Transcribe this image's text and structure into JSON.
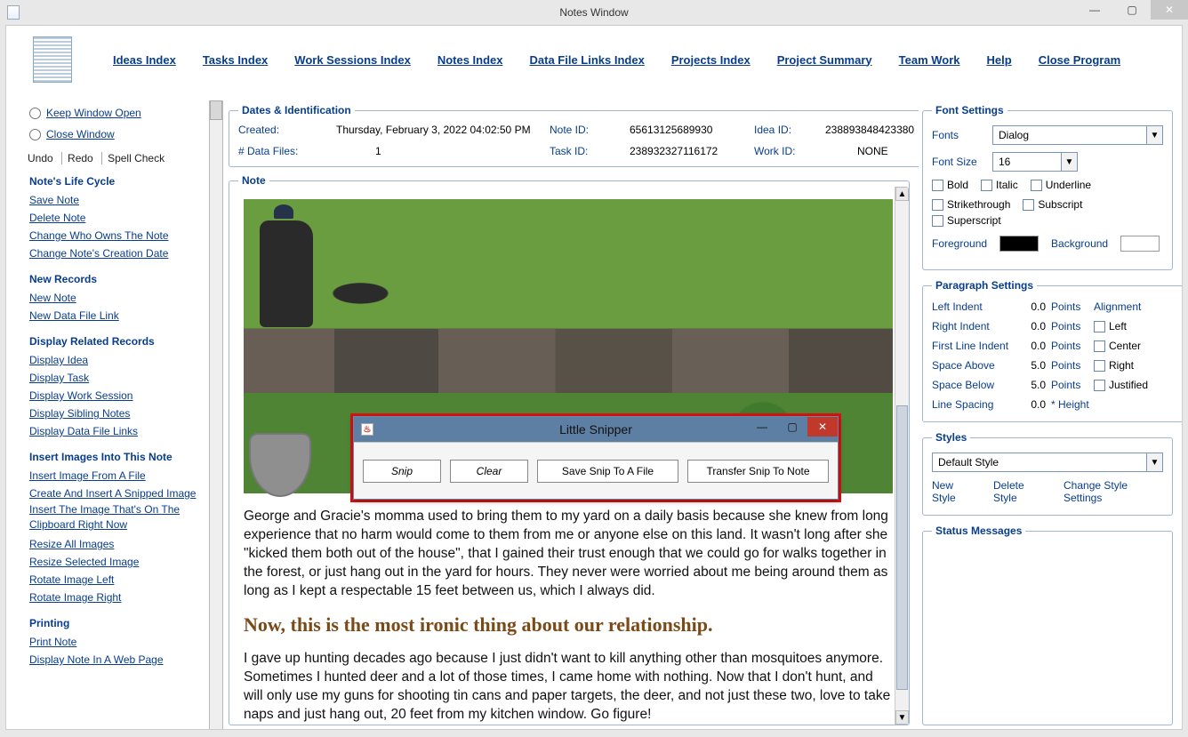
{
  "window": {
    "title": "Notes Window",
    "minimize": "—",
    "maximize": "▢",
    "close": "✕"
  },
  "menubar": {
    "ideas": "Ideas Index",
    "tasks": "Tasks Index",
    "work": "Work Sessions Index",
    "notes": "Notes Index",
    "files": "Data File Links Index",
    "projects": "Projects Index",
    "summary": "Project Summary",
    "team": "Team Work",
    "help": "Help",
    "close": "Close Program"
  },
  "left": {
    "keep_open": "Keep Window Open",
    "close_window": "Close Window",
    "undo": "Undo",
    "redo": "Redo",
    "spell": "Spell Check",
    "life_hdr": "Note's Life Cycle",
    "save": "Save Note",
    "delete": "Delete Note",
    "owner": "Change Who Owns The Note",
    "cdate": "Change Note's Creation Date",
    "new_hdr": "New Records",
    "new_note": "New Note",
    "new_link": "New Data File Link",
    "disp_hdr": "Display Related Records",
    "disp_idea": "Display Idea",
    "disp_task": "Display Task",
    "disp_ws": "Display Work Session",
    "disp_sib": "Display Sibling Notes",
    "disp_dfl": "Display Data File Links",
    "img_hdr": "Insert Images Into This Note",
    "img_file": "Insert Image From A File",
    "img_snip": "Create And Insert A Snipped Image",
    "img_clip": "Insert The Image That's On The Clipboard Right Now",
    "img_resize_all": "Resize All Images",
    "img_resize_sel": "Resize Selected Image",
    "img_rot_l": "Rotate Image Left",
    "img_rot_r": "Rotate Image Right",
    "print_hdr": "Printing",
    "print_note": "Print Note",
    "print_web": "Display Note In A Web Page"
  },
  "ident": {
    "legend": "Dates & Identification",
    "created_lbl": "Created:",
    "created_val": "Thursday, February 3, 2022   04:02:50 PM",
    "files_lbl": "# Data Files:",
    "files_val": "1",
    "noteid_lbl": "Note ID:",
    "noteid_val": "65613125689930",
    "taskid_lbl": "Task ID:",
    "taskid_val": "238932327116172",
    "ideaid_lbl": "Idea ID:",
    "ideaid_val": "238893848423380",
    "workid_lbl": "Work ID:",
    "workid_val": "NONE"
  },
  "note": {
    "legend": "Note",
    "para1": "George and Gracie's momma used to bring them to my yard on a daily basis because she knew from long experience that no harm would come to them from me or anyone else on this land. It wasn't long after she \"kicked them both out of the house\", that I gained their trust enough that we could go for walks together in the forest, or just hang out in the yard for hours. They never were worried about me being around them as long as I kept a respectable 15 feet between us, which I always did.",
    "fancy": "Now, this is the most ironic thing about our relationship.",
    "para2": "I gave up hunting decades ago because I just didn't want to kill anything other than mosquitoes anymore. Sometimes I hunted deer and a lot of those times, I came home with nothing. Now that I don't hunt, and will only use my guns for shooting tin cans and paper targets, the deer, and not just these two, love to take naps and just hang out, 20 feet from my kitchen window. Go figure!"
  },
  "snipper": {
    "title": "Little Snipper",
    "snip": "Snip",
    "clear": "Clear",
    "save": "Save Snip To A File",
    "transfer": "Transfer Snip To Note",
    "min": "—",
    "max": "▢",
    "close": "✕"
  },
  "font": {
    "legend": "Font Settings",
    "fonts_lbl": "Fonts",
    "fonts_val": "Dialog",
    "size_lbl": "Font Size",
    "size_val": "16",
    "bold": "Bold",
    "italic": "Italic",
    "underline": "Underline",
    "strike": "Strikethrough",
    "sub": "Subscript",
    "sup": "Superscript",
    "fg": "Foreground",
    "bg": "Background"
  },
  "para": {
    "legend": "Paragraph Settings",
    "left_indent": "Left Indent",
    "right_indent": "Right Indent",
    "first_line": "First Line Indent",
    "space_above": "Space Above",
    "space_below": "Space Below",
    "line_spacing": "Line Spacing",
    "v_left": "0.0",
    "v_right": "0.0",
    "v_first": "0.0",
    "v_above": "5.0",
    "v_below": "5.0",
    "v_line": "0.0",
    "points": "Points",
    "height": "* Height",
    "align_lbl": "Alignment",
    "a_left": "Left",
    "a_center": "Center",
    "a_right": "Right",
    "a_just": "Justified"
  },
  "styles": {
    "legend": "Styles",
    "default": "Default Style",
    "new": "New Style",
    "delete": "Delete Style",
    "change": "Change Style Settings"
  },
  "status": {
    "legend": "Status Messages"
  }
}
